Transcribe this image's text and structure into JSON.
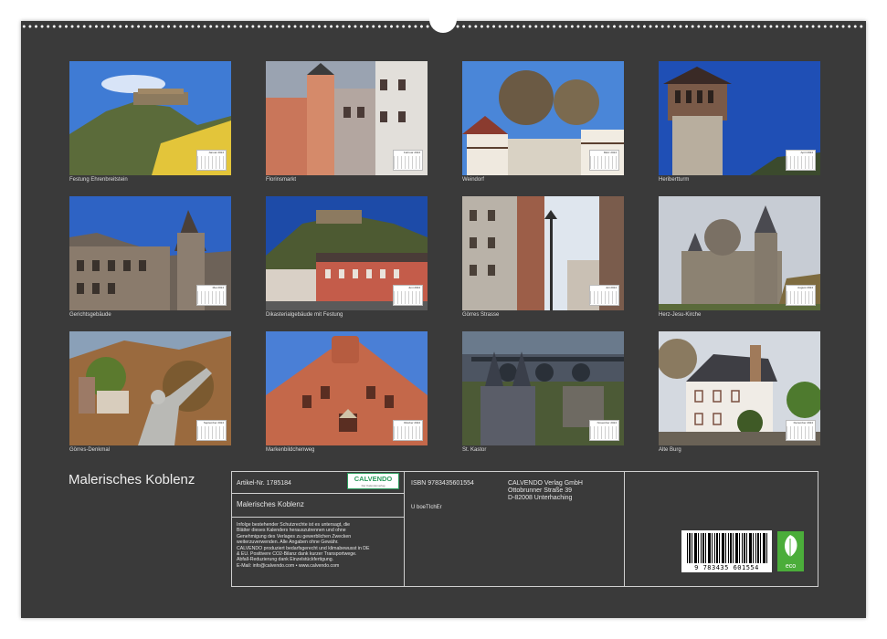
{
  "colors": {
    "sheet": "#3a3a3a",
    "text": "#e6e6e6",
    "calvendo_green": "#2a9b5b",
    "eco_green": "#4bad3a"
  },
  "photos": [
    {
      "caption": "Festung Ehrenbreitstein",
      "month": "Januar 2024"
    },
    {
      "caption": "Florinsmarkt",
      "month": "Februar 2024"
    },
    {
      "caption": "Weindorf",
      "month": "März 2024"
    },
    {
      "caption": "Heribertturm",
      "month": "April 2024"
    },
    {
      "caption": "Gerichtsgebäude",
      "month": "Mai 2024"
    },
    {
      "caption": "Dikasterialgebäude mit Festung",
      "month": "Juni 2024"
    },
    {
      "caption": "Görres Strasse",
      "month": "Juli 2024"
    },
    {
      "caption": "Herz-Jesu-Kirche",
      "month": "August 2024"
    },
    {
      "caption": "Görres-Denkmal",
      "month": "September 2024"
    },
    {
      "caption": "Markenbildchenweg",
      "month": "Oktober 2024"
    },
    {
      "caption": "St. Kastor",
      "month": "November 2024"
    },
    {
      "caption": "Alte Burg",
      "month": "Dezember 2024"
    }
  ],
  "calendar_title": "Malerisches Koblenz",
  "info": {
    "article": "Artikel-Nr. 1785184",
    "title_repeat": "Malerisches Koblenz",
    "isbn": "ISBN 9783435601554",
    "publisher": [
      "CALVENDO Verlag GmbH",
      "Ottobrunner Straße 39",
      "D-82008 Unterhaching"
    ],
    "author_code": "U boeTIchEr",
    "legal": [
      "Infolge bestehender Schutzrechte ist es untersagt, die",
      "Blätter dieses Kalenders herauszutrennen und ohne",
      "Genehmigung des Verlages zu gewerblichen Zwecken",
      "weiterzuverwenden. Alle Angaben ohne Gewähr.",
      "CALVENDO produziert bedarfsgerecht und klimabewusst in DE",
      "& EU. Positivere CO2-Bilanz dank kurzer Transportwege.",
      "Abfall-Reduzierung dank Einzelstückfertigung.",
      "E-Mail: info@calvendo.com • www.calvendo.com"
    ]
  },
  "logo": {
    "name": "CALVENDO",
    "tagline": "Der Kalenderverlag"
  },
  "barcode": {
    "digits": "9 783435 601554"
  },
  "eco_label": "eco"
}
